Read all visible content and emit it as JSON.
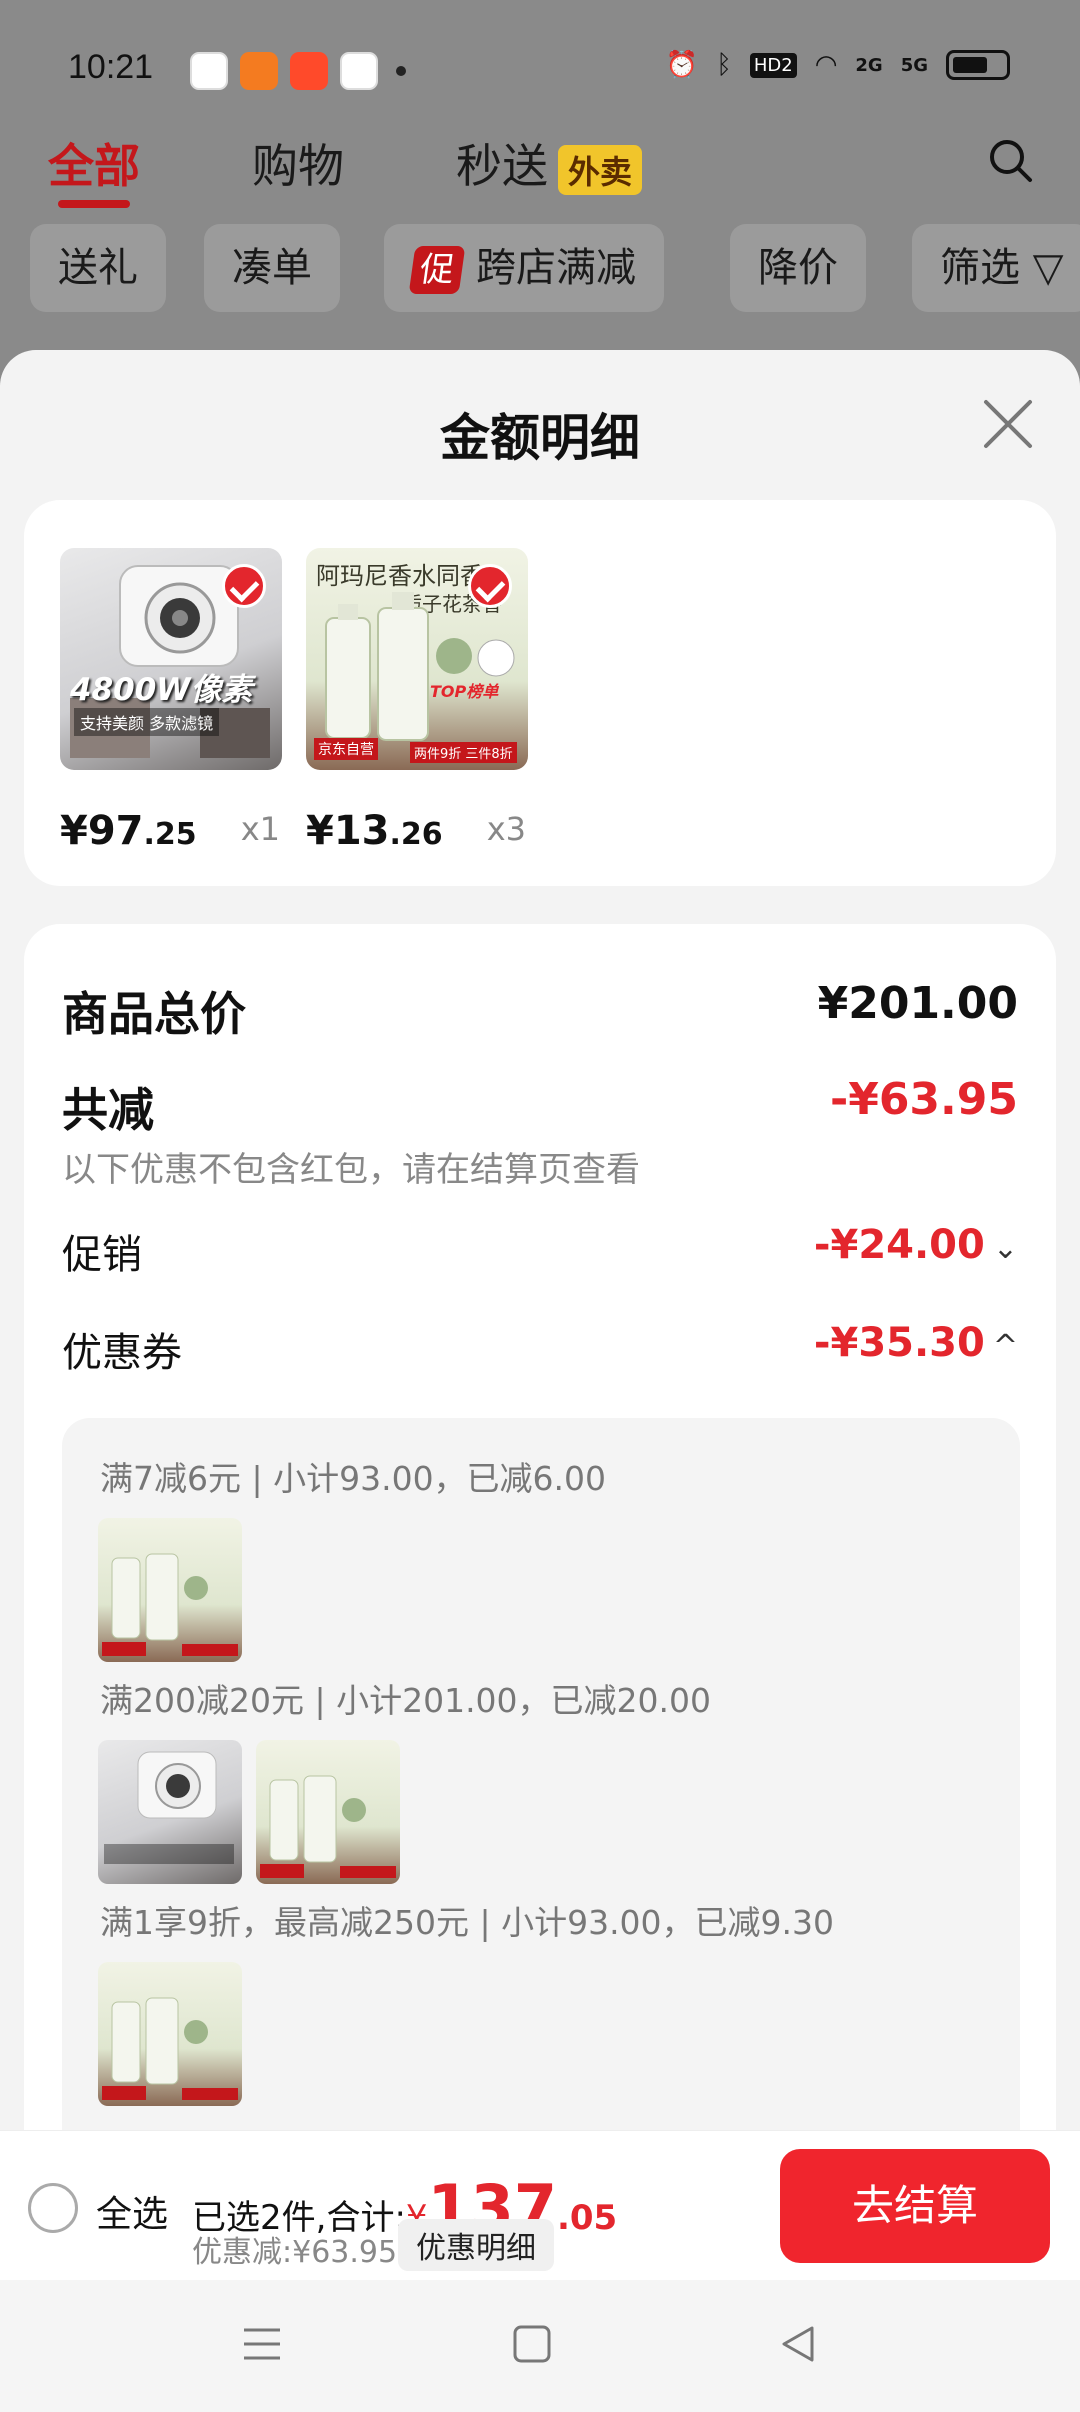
{
  "status_bar": {
    "time": "10:21",
    "net2g": "2G",
    "net5g": "5G",
    "hd": "HD2"
  },
  "top_tabs": [
    {
      "label": "全部",
      "active": true
    },
    {
      "label": "购物",
      "active": false
    },
    {
      "label": "秒送",
      "active": false,
      "badge": "外卖"
    }
  ],
  "filter_chips": [
    "送礼",
    "凑单",
    "跨店满减",
    "降价",
    "筛选"
  ],
  "promo_tag": "促",
  "sheet": {
    "title": "金额明细"
  },
  "products": [
    {
      "price_int": "¥97",
      "price_dec": ".25",
      "qty": "x1",
      "img_text": "4800W像素",
      "img_sub": "支持美颜 多款滤镜"
    },
    {
      "price_int": "¥13",
      "price_dec": ".26",
      "qty": "x3",
      "img_text": "阿玛尼香水同香",
      "img_sub": "栀子花茶香",
      "img_tag": "TOP榜单",
      "img_badge": "京东自营",
      "img_offer": "两件9折 三件8折"
    }
  ],
  "summary": {
    "total_label": "商品总价",
    "total_value": "¥201.00",
    "reduce_label": "共减",
    "reduce_value": "-¥63.95",
    "note": "以下优惠不包含红包，请在结算页查看",
    "promo_label": "促销",
    "promo_value": "-¥24.00",
    "coupon_label": "优惠券",
    "coupon_value": "-¥35.30"
  },
  "coupon_lines": [
    "满7减6元 | 小计93.00，已减6.00",
    "满200减20元 | 小计201.00，已减20.00",
    "满1享9折，最高减250元 | 小计93.00，已减9.30"
  ],
  "bottom_bar": {
    "select_all": "全选",
    "selected_text": "已选2件,合计:",
    "yen": "¥",
    "amount_int": "137",
    "amount_dec": ".05",
    "discount_text": "优惠减:¥63.95",
    "detail_button": "优惠明细",
    "checkout_button": "去结算"
  },
  "colors": {
    "accent": "#e3262d",
    "brand_red": "#c4171b",
    "waimai_yellow": "#f1c52b"
  }
}
